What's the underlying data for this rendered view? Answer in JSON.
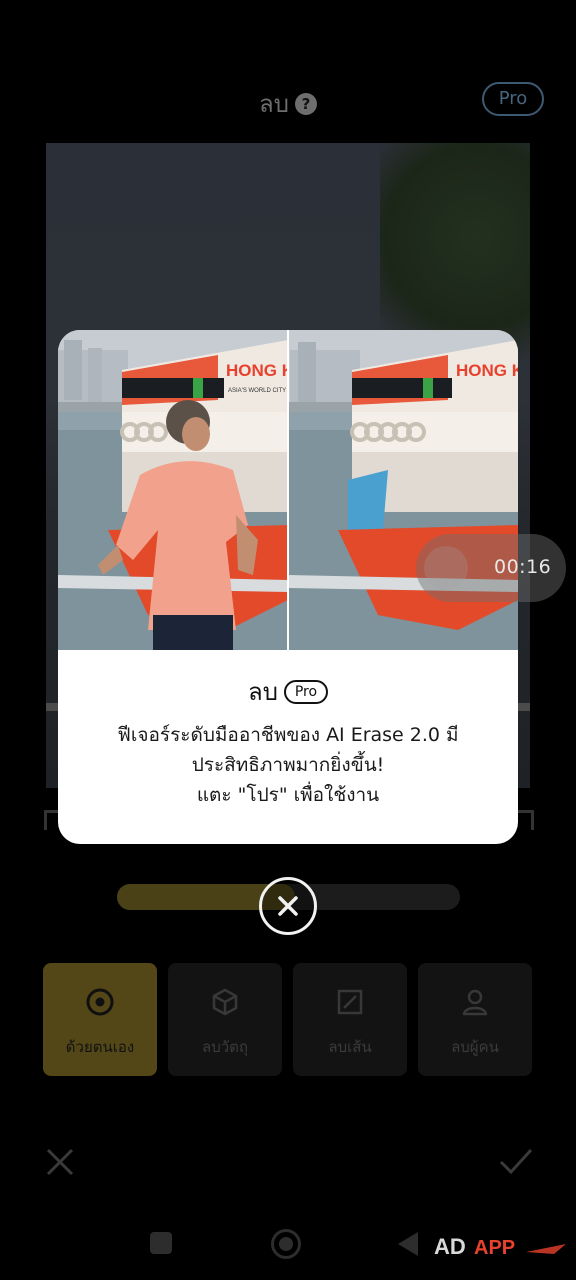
{
  "header": {
    "title": "ลบ",
    "help_icon": "question-circle-icon",
    "pro_label": "Pro"
  },
  "editor": {
    "brush_size_fraction": 0.52,
    "tools": [
      {
        "label": "ด้วยตนเอง",
        "icon": "target-icon",
        "active": true
      },
      {
        "label": "ลบวัตถุ",
        "icon": "cube-icon",
        "active": false
      },
      {
        "label": "ลบเส้น",
        "icon": "line-square-icon",
        "active": false
      },
      {
        "label": "ลบผู้คน",
        "icon": "person-icon",
        "active": false
      }
    ]
  },
  "modal": {
    "title": "ลบ",
    "pro_badge": "Pro",
    "description_lines": [
      "ฟีเจอร์ระดับมืออาชีพของ AI Erase 2.0 มี",
      "ประสิทธิภาพมากยิ่งขึ้น!",
      "แตะ \"โปร\" เพื่อใช้งาน"
    ],
    "ferry_sign_before": "HONG KONG",
    "ferry_sign_after": "HONG KONG",
    "ferry_tagline": "ASIA'S WORLD CITY"
  },
  "overlay": {
    "timer": "00:16"
  },
  "watermark": {
    "brand": "ADAPP"
  },
  "colors": {
    "accent_active_tool": "#544717",
    "slider_fill": "#4a4116",
    "pro_outline": "#3e5a73"
  }
}
